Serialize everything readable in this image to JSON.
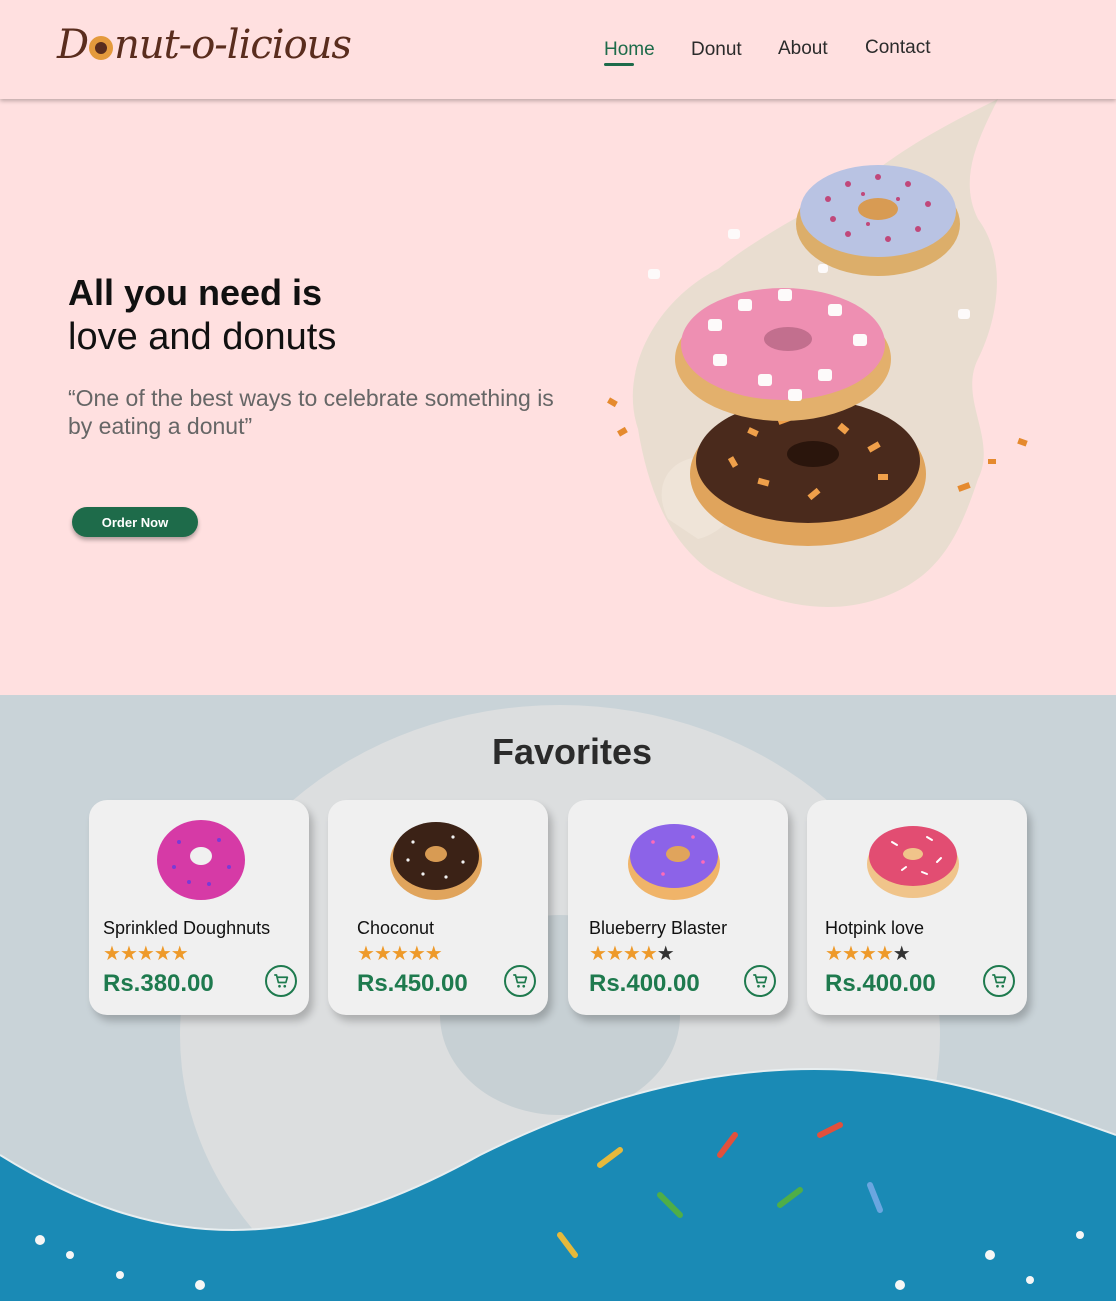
{
  "brand": {
    "name_before": "D",
    "name_after": "nut-o-licious"
  },
  "nav": {
    "items": [
      {
        "label": "Home",
        "active": true
      },
      {
        "label": "Donut",
        "active": false
      },
      {
        "label": "About",
        "active": false
      },
      {
        "label": "Contact",
        "active": false
      }
    ]
  },
  "hero": {
    "title_line1": "All you need is",
    "title_line2": "love and donuts",
    "quote": "“One of the best ways to celebrate something is by eating a donut”",
    "cta_label": "Order Now"
  },
  "favorites": {
    "title": "Favorites",
    "items": [
      {
        "name": "Sprinkled Doughnuts",
        "rating": 5,
        "max_rating": 5,
        "price": "Rs.380.00",
        "glaze": "#d63aa6",
        "sprinkle": "#7a3ad6"
      },
      {
        "name": "Choconut",
        "rating": 5,
        "max_rating": 5,
        "price": "Rs.450.00",
        "glaze": "#3b2216",
        "sprinkle": "#f2f2f2"
      },
      {
        "name": "Blueberry Blaster",
        "rating": 4,
        "max_rating": 5,
        "price": "Rs.400.00",
        "glaze": "#8c63e8",
        "sprinkle": "#ff6ab8"
      },
      {
        "name": "Hotpink love",
        "rating": 4,
        "max_rating": 5,
        "price": "Rs.400.00",
        "glaze": "#e24d72",
        "sprinkle": "#ffffff"
      }
    ]
  },
  "colors": {
    "accent_green": "#1e6b4a",
    "price_green": "#1e7a4e",
    "hero_bg": "#ffe0e0",
    "star": "#ee9a2a",
    "footer_blue": "#1a8ab5"
  }
}
